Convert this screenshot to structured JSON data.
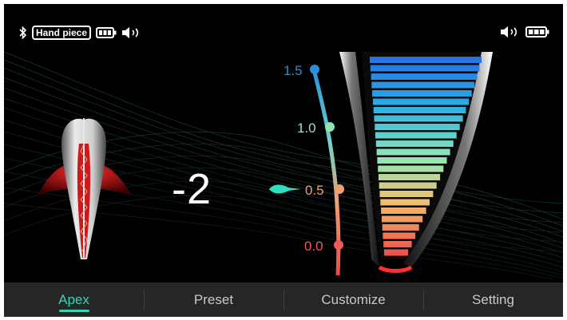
{
  "status_bar": {
    "left_icons": [
      "bluetooth-icon",
      "battery-icon",
      "volume-icon"
    ],
    "handpiece_label": "Hand piece",
    "right_icons": [
      "volume-icon",
      "battery-icon"
    ]
  },
  "apex": {
    "reading": "-2",
    "scale_ticks": [
      {
        "label": "1.5",
        "color": "#2a8fd8"
      },
      {
        "label": "1.0",
        "color": "#8fe6b0"
      },
      {
        "label": "0.5",
        "color": "#f0a070"
      },
      {
        "label": "0.0",
        "color": "#f05a5a"
      }
    ],
    "current_tick": "0.5",
    "pointer_color": "#2ee0c0"
  },
  "nav": {
    "tabs": [
      {
        "label": "Apex",
        "active": true
      },
      {
        "label": "Preset",
        "active": false
      },
      {
        "label": "Customize",
        "active": false
      },
      {
        "label": "Setting",
        "active": false
      }
    ],
    "accent": "#35d6b8"
  }
}
